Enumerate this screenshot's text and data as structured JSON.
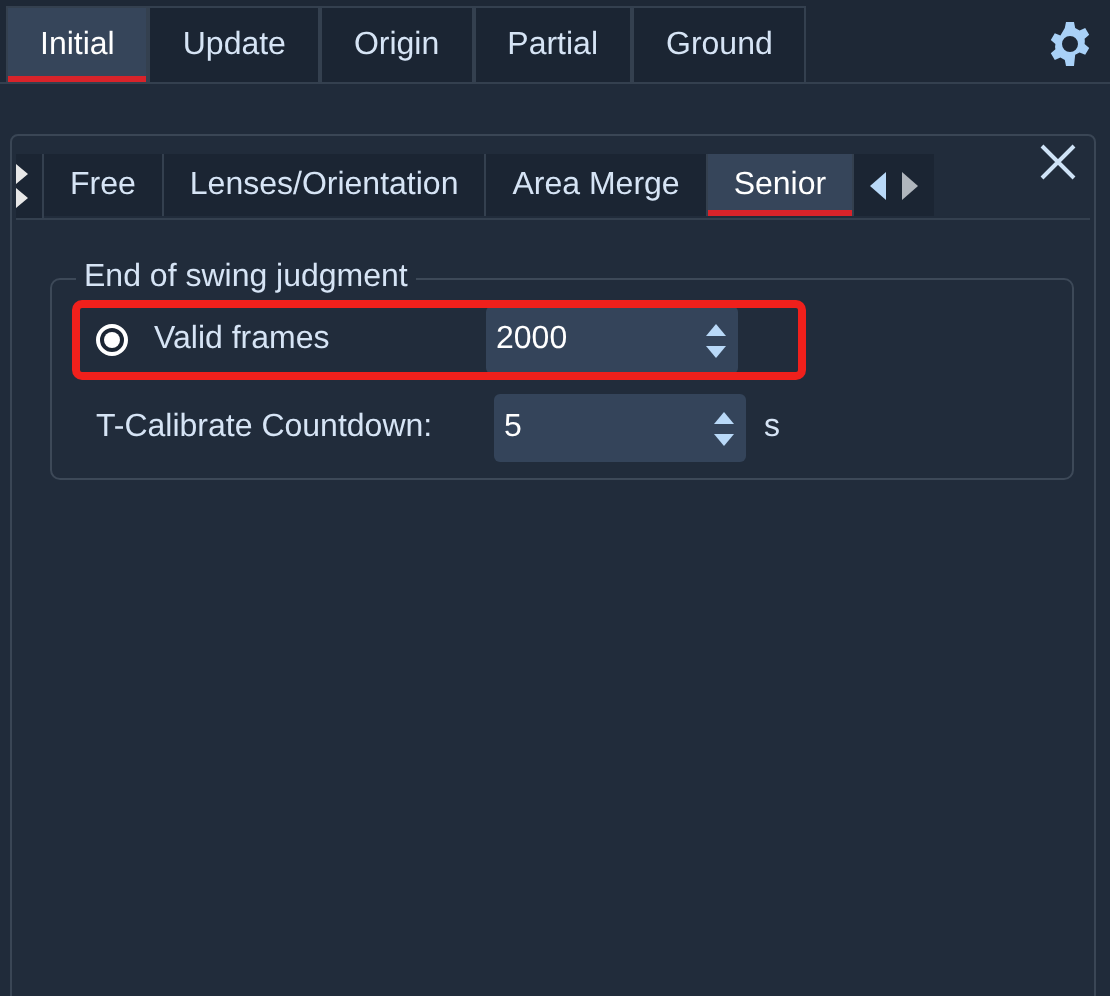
{
  "top_tabs": [
    {
      "label": "Initial",
      "selected": true
    },
    {
      "label": "Update",
      "selected": false
    },
    {
      "label": "Origin",
      "selected": false
    },
    {
      "label": "Partial",
      "selected": false
    },
    {
      "label": "Ground",
      "selected": false
    }
  ],
  "panel": {
    "tabs": [
      {
        "label": "Free",
        "selected": false
      },
      {
        "label": "Lenses/Orientation",
        "selected": false
      },
      {
        "label": "Area Merge",
        "selected": false
      },
      {
        "label": "Senior",
        "selected": true
      }
    ],
    "group": {
      "title": "End of swing judgment",
      "rows": [
        {
          "kind": "radio",
          "label": "Valid frames",
          "checked": true,
          "value": "2000",
          "highlighted": true
        },
        {
          "kind": "spin",
          "label": "T-Calibrate Countdown:",
          "value": "5",
          "unit": "s",
          "highlighted": false
        }
      ]
    }
  }
}
